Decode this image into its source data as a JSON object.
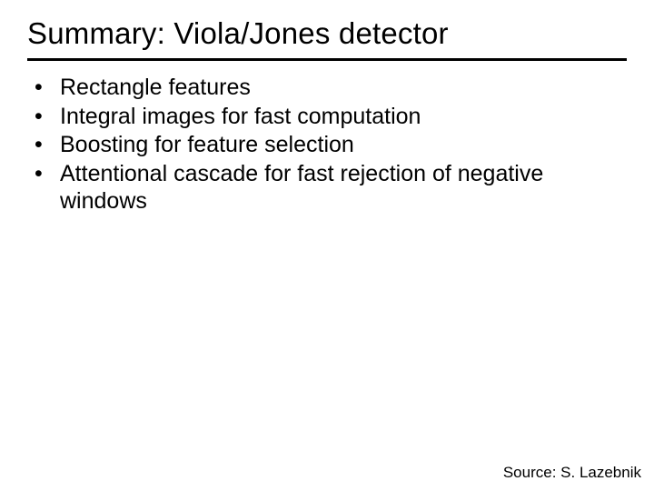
{
  "title": "Summary: Viola/Jones detector",
  "bullets": [
    "Rectangle features",
    "Integral images for fast computation",
    "Boosting for feature selection",
    "Attentional cascade for fast rejection of negative windows"
  ],
  "source": "Source: S. Lazebnik"
}
